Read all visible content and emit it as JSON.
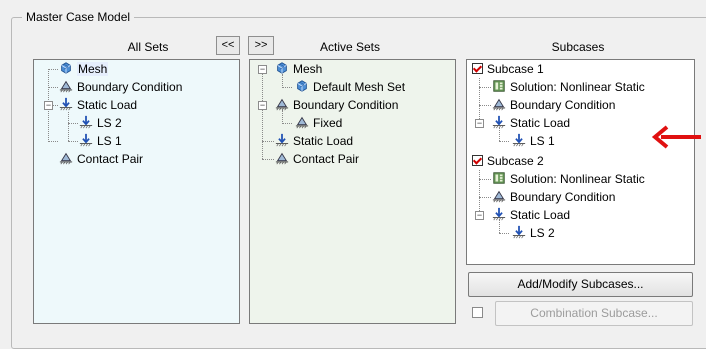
{
  "group_title": "Master Case Model",
  "columns": {
    "all_sets": "All Sets",
    "active_sets": "Active Sets",
    "subcases": "Subcases"
  },
  "buttons": {
    "move_left": "<<",
    "move_right": ">>",
    "add_modify": "Add/Modify Subcases...",
    "combination": "Combination Subcase..."
  },
  "all_sets": {
    "mesh": "Mesh",
    "boundary_condition": "Boundary Condition",
    "static_load": "Static Load",
    "ls2": "LS 2",
    "ls1": "LS 1",
    "contact_pair": "Contact Pair"
  },
  "active_sets": {
    "mesh": "Mesh",
    "default_mesh_set": "Default Mesh Set",
    "boundary_condition": "Boundary Condition",
    "fixed": "Fixed",
    "static_load": "Static Load",
    "contact_pair": "Contact Pair"
  },
  "subcases": {
    "subcase1": {
      "label": "Subcase 1",
      "checked": true,
      "solution": "Solution: Nonlinear Static",
      "boundary_condition": "Boundary Condition",
      "static_load": "Static Load",
      "ls": "LS 1"
    },
    "subcase2": {
      "label": "Subcase 2",
      "checked": true,
      "solution": "Solution: Nonlinear Static",
      "boundary_condition": "Boundary Condition",
      "static_load": "Static Load",
      "ls": "LS 2"
    }
  },
  "combination_checked": false,
  "colors": {
    "all_sets_bg": "#eef9fb",
    "active_sets_bg": "#eef4ec",
    "arrow": "#e01010",
    "check": "#d00000"
  },
  "icons": {
    "mesh": "mesh-cube-icon",
    "boundary": "boundary-condition-icon",
    "load": "static-load-arrow-icon",
    "solution": "solution-table-icon"
  }
}
